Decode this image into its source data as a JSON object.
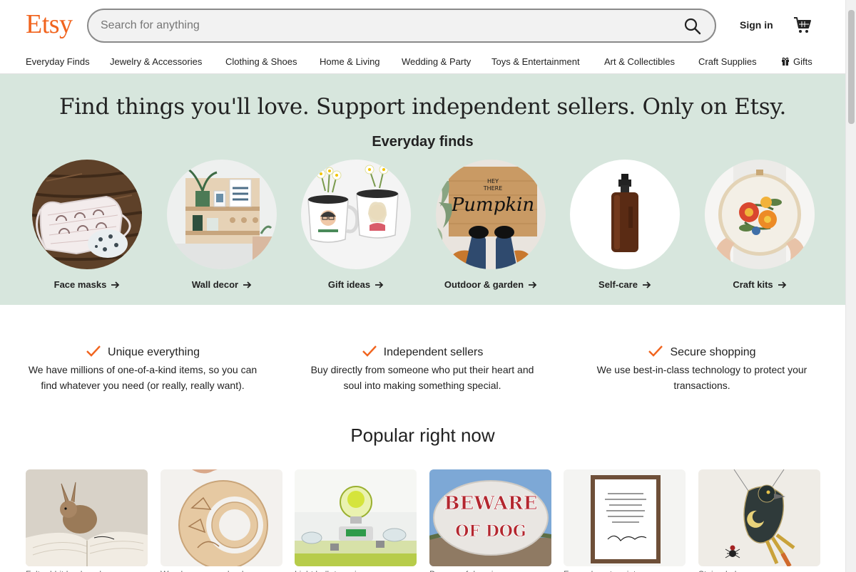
{
  "header": {
    "logo": "Etsy",
    "search": {
      "placeholder": "Search for anything",
      "value": ""
    },
    "sign_in": "Sign in",
    "brand_color": "#F1641E"
  },
  "nav": {
    "items": [
      {
        "label": "Everyday Finds"
      },
      {
        "label": "Jewelry & Accessories"
      },
      {
        "label": "Clothing & Shoes"
      },
      {
        "label": "Home & Living"
      },
      {
        "label": "Wedding & Party"
      },
      {
        "label": "Toys & Entertainment"
      },
      {
        "label": "Art & Collectibles"
      },
      {
        "label": "Craft Supplies"
      },
      {
        "label": "Gifts",
        "icon": "gift-icon"
      }
    ]
  },
  "hero": {
    "title": "Find things you'll love. Support independent sellers. Only on Etsy.",
    "subtitle": "Everyday finds",
    "background": "#D7E6DD",
    "categories": [
      {
        "label": "Face masks"
      },
      {
        "label": "Wall decor"
      },
      {
        "label": "Gift ideas"
      },
      {
        "label": "Outdoor & garden",
        "doormat_line1": "HEY",
        "doormat_line2": "THERE",
        "doormat_word": "Pumpkin"
      },
      {
        "label": "Self-care"
      },
      {
        "label": "Craft kits"
      }
    ]
  },
  "features": [
    {
      "title": "Unique everything",
      "body": "We have millions of one-of-a-kind items, so you can find whatever you need (or really, really want)."
    },
    {
      "title": "Independent sellers",
      "body": "Buy directly from someone who put their heart and soul into making something special."
    },
    {
      "title": "Secure shopping",
      "body": "We use best-in-class technology to protect your transactions."
    }
  ],
  "popular": {
    "title": "Popular right now",
    "products": [
      {
        "name": "Felt rabbit bookmark"
      },
      {
        "name": "Wooden moon calendar"
      },
      {
        "name": "Light bulb terrarium"
      },
      {
        "name": "Beware of dog sign",
        "sign_line1": "BEWARE",
        "sign_line2": "OF DOG"
      },
      {
        "name": "Framed quote print"
      },
      {
        "name": "Stained glass raven"
      }
    ]
  }
}
